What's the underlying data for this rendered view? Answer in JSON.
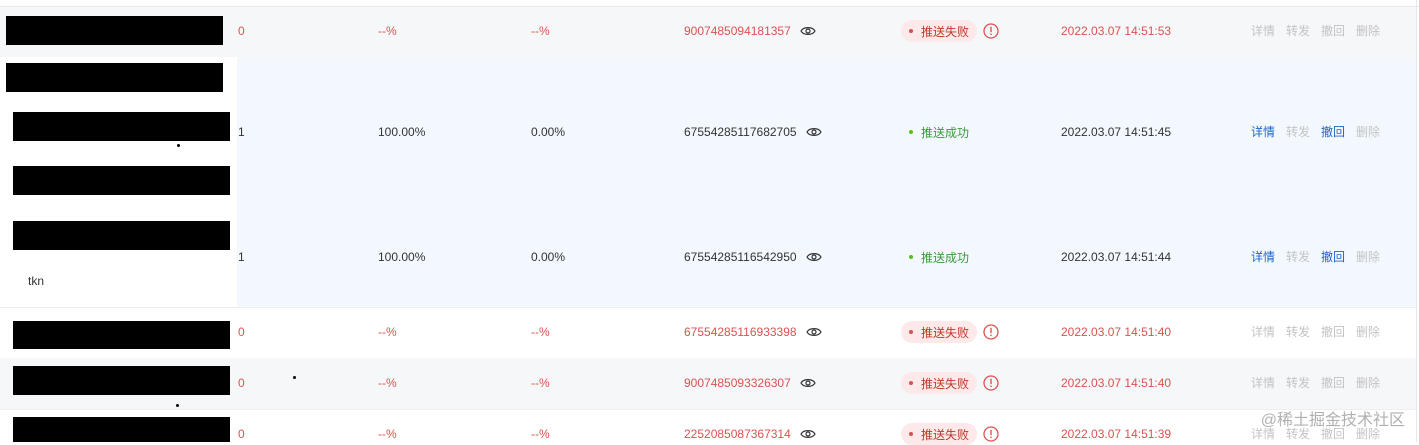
{
  "actions": [
    "详情",
    "转发",
    "撤回",
    "删除"
  ],
  "extra_text": "tkn",
  "watermark": "@稀土掘金技术社区",
  "colors": {
    "fail_text": "#d9534f",
    "success_dot": "#52c41a",
    "link_blue": "#1f64c8",
    "disabled": "#c3c3c3"
  },
  "rows": [
    {
      "count": "0",
      "rate1": "--%",
      "rate2": "--%",
      "id": "9007485094181357",
      "status": "推送失败",
      "time": "2022.03.07 14:51:53",
      "state": "fail",
      "enabled": [
        false,
        false,
        false,
        false
      ]
    },
    {
      "count": "1",
      "rate1": "100.00%",
      "rate2": "0.00%",
      "id": "67554285117682705",
      "status": "推送成功",
      "time": "2022.03.07 14:51:45",
      "state": "success",
      "enabled": [
        true,
        false,
        true,
        false
      ]
    },
    {
      "count": "1",
      "rate1": "100.00%",
      "rate2": "0.00%",
      "id": "67554285116542950",
      "status": "推送成功",
      "time": "2022.03.07 14:51:44",
      "state": "success",
      "enabled": [
        true,
        false,
        true,
        false
      ]
    },
    {
      "count": "0",
      "rate1": "--%",
      "rate2": "--%",
      "id": "67554285116933398",
      "status": "推送失败",
      "time": "2022.03.07 14:51:40",
      "state": "fail",
      "enabled": [
        false,
        false,
        false,
        false
      ]
    },
    {
      "count": "0",
      "rate1": "--%",
      "rate2": "--%",
      "id": "9007485093326307",
      "status": "推送失败",
      "time": "2022.03.07 14:51:40",
      "state": "fail",
      "enabled": [
        false,
        false,
        false,
        false
      ]
    },
    {
      "count": "0",
      "rate1": "--%",
      "rate2": "--%",
      "id": "2252085087367314",
      "status": "推送失败",
      "time": "2022.03.07 14:51:39",
      "state": "fail",
      "enabled": [
        false,
        false,
        false,
        false
      ]
    }
  ]
}
